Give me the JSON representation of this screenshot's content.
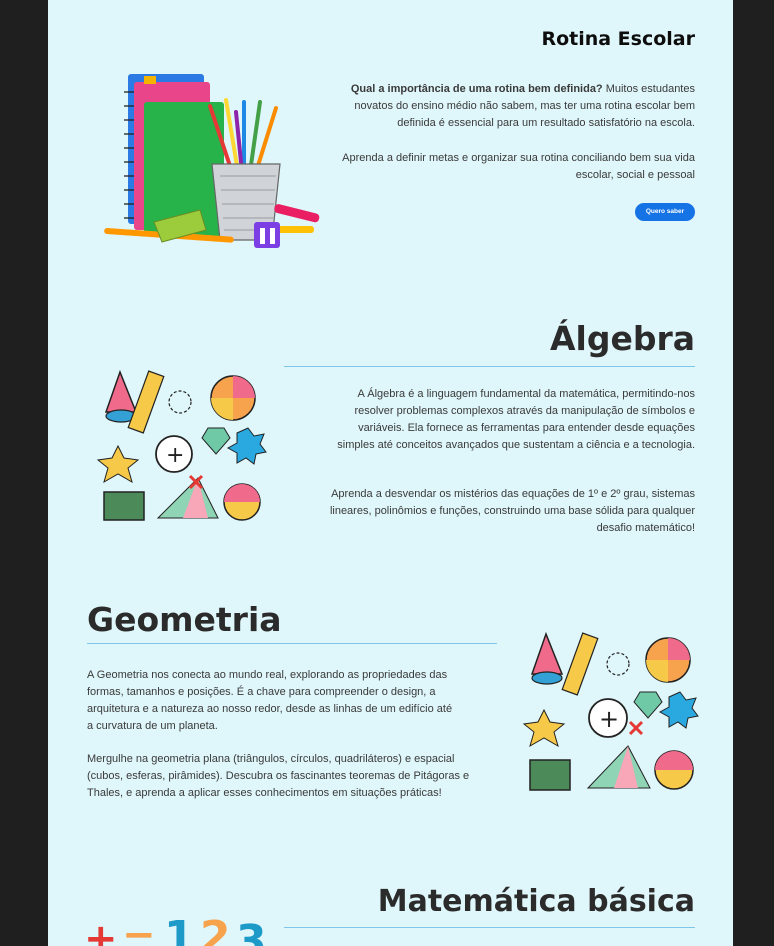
{
  "rotina": {
    "title": "Rotina Escolar",
    "p1_bold": "Qual a importância de uma rotina bem definida?",
    "p1_rest": " Muitos estudantes novatos do ensino médio não sabem, mas ter uma rotina escolar bem definida é essencial para um resultado satisfatório na escola.",
    "p2": "Aprenda a definir metas e organizar sua rotina conciliando bem sua vida escolar, social e pessoal",
    "button": "Quero saber"
  },
  "algebra": {
    "title": "Álgebra",
    "p1": "A Álgebra é a linguagem fundamental da matemática, permitindo-nos resolver problemas complexos através da manipulação de símbolos e variáveis. Ela fornece as ferramentas para entender desde equações simples até conceitos avançados que sustentam a ciência e a tecnologia.",
    "p2": "Aprenda a desvendar os mistérios das equações de 1º e 2º grau, sistemas lineares, polinômios e funções, construindo uma base sólida para qualquer desafio matemático!"
  },
  "geometria": {
    "title": "Geometria",
    "p1": "A Geometria nos conecta ao mundo real, explorando as propriedades das formas, tamanhos e posições. É a chave para compreender o design, a arquitetura e a natureza ao nosso redor, desde as linhas de um edifício até a curvatura de um planeta.",
    "p2": "Mergulhe na geometria plana (triângulos, círculos, quadriláteros) e espacial (cubos, esferas, pirâmides). Descubra os fascinantes teoremas de Pitágoras e Thales, e aprenda a aplicar esses conhecimentos em situações práticas!"
  },
  "basica": {
    "title": "Matemática básica"
  },
  "colors": {
    "page_bg": "#dff6fa",
    "outer_bg": "#1f1f1f",
    "accent": "#1673e6",
    "rule": "#7fc7e8"
  }
}
